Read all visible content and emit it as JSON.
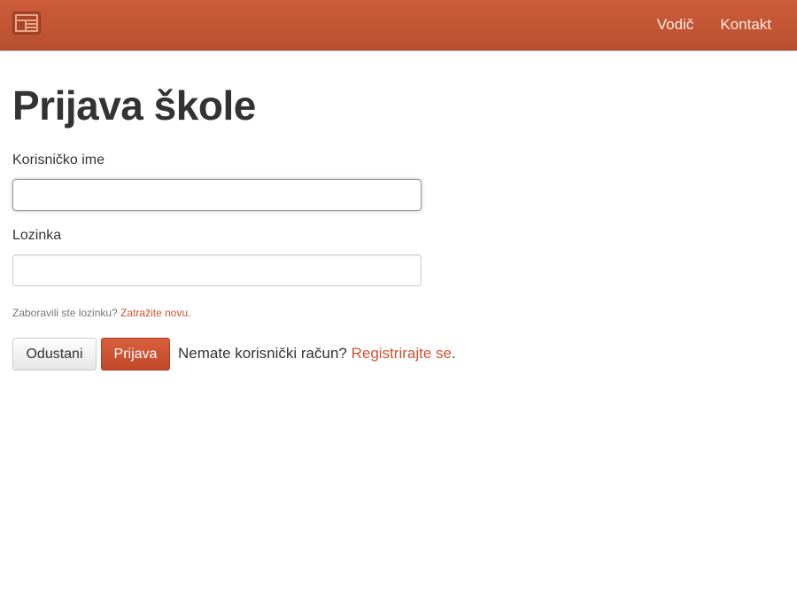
{
  "navbar": {
    "brand_icon": "newspaper-icon",
    "links": [
      "Vodič",
      "Kontakt"
    ]
  },
  "page": {
    "title": "Prijava škole"
  },
  "form": {
    "username_label": "Korisničko ime",
    "username_value": "",
    "password_label": "Lozinka",
    "password_value": "",
    "forgot_text": "Zaboravili ste lozinku?",
    "forgot_link": "Zatražite novu.",
    "cancel_label": "Odustani",
    "login_label": "Prijava",
    "register_text": "Nemate korisnički račun?",
    "register_link": "Registrirajte se",
    "register_suffix": "."
  },
  "colors": {
    "navbar": "#c4553a",
    "accent": "#cd5433",
    "text": "#333333"
  }
}
